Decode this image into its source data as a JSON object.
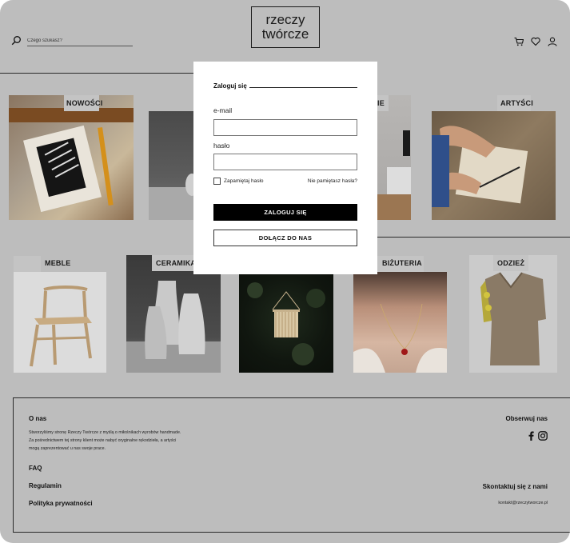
{
  "header": {
    "logo_line1": "rzeczy",
    "logo_line2": "twórcze",
    "search_placeholder": "Czego szukasz?",
    "icons": [
      "search-icon",
      "cart-icon",
      "heart-icon",
      "user-icon"
    ]
  },
  "categories_row1": [
    {
      "label": "NOWOŚCI"
    },
    {
      "label": ""
    },
    {
      "label": "IE"
    },
    {
      "label": "ARTYŚCI"
    }
  ],
  "categories_row2": [
    {
      "label": "MEBLE"
    },
    {
      "label": "CERAMIKA"
    },
    {
      "label": ""
    },
    {
      "label": "BIŻUTERIA"
    },
    {
      "label": "ODZIEŻ"
    }
  ],
  "login": {
    "title": "Zaloguj się",
    "email_label": "e-mail",
    "password_label": "hasło",
    "remember_label": "Zapamiętaj hasło",
    "forgot_label": "Nie pamiętasz hasła?",
    "login_button": "ZALOGUJ SIĘ",
    "join_button": "DOŁĄCZ DO NAS"
  },
  "footer": {
    "about_title": "O nas",
    "about_line1": "Stworzyliśmy stronę Rzeczy Twórcze  z myślą o miłośnikach wyrobów handmade.",
    "about_line2": "Za pośrednictwem tej strony klient może nabyć oryginalne  rękodzieła,  a artyści",
    "about_line3": "mogą zaprezentować u nas swoje prace.",
    "faq": "FAQ",
    "terms": "Regulamin",
    "privacy": "Polityka prywatności",
    "follow_title": "Obserwuj nas",
    "contact_title": "Skontaktuj się z nami",
    "contact_email": "kontakt@rzeczytworcze.pl"
  },
  "colors": {
    "overlay": "#bdbdbd",
    "primary_button": "#000000",
    "modal_bg": "#ffffff"
  }
}
